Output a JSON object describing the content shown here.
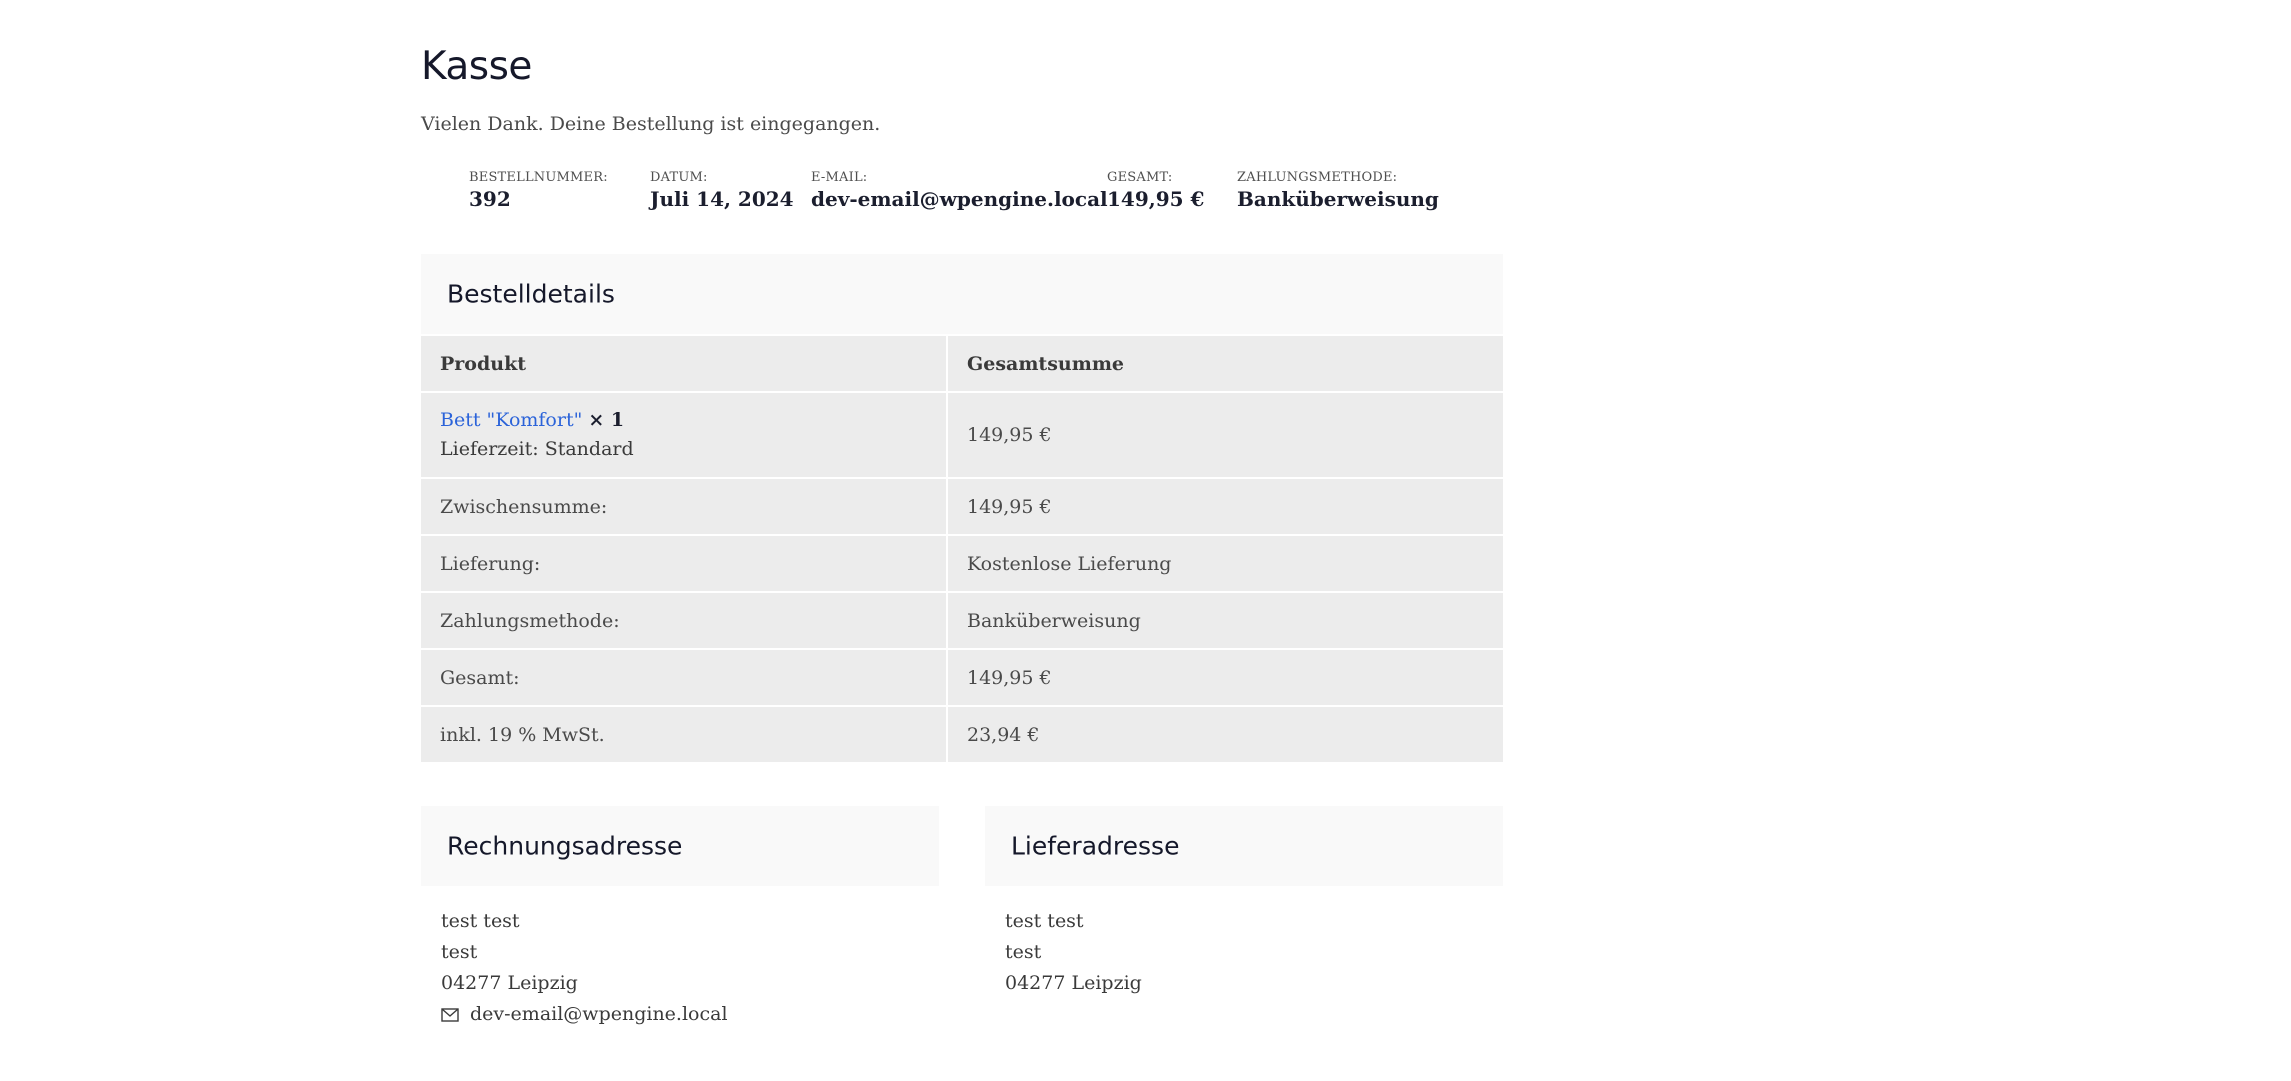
{
  "page": {
    "title": "Kasse",
    "thanks": "Vielen Dank. Deine Bestellung ist eingegangen."
  },
  "overview": {
    "order_number": {
      "label": "BESTELLNUMMER:",
      "value": "392"
    },
    "date": {
      "label": "DATUM:",
      "value": "Juli 14, 2024"
    },
    "email": {
      "label": "E-MAIL:",
      "value": "dev-email@wpengine.local"
    },
    "total": {
      "label": "GESAMT:",
      "value": "149,95 €"
    },
    "payment_method": {
      "label": "ZAHLUNGSMETHODE:",
      "value": "Banküberweisung"
    }
  },
  "order_details": {
    "heading": "Bestelldetails",
    "columns": [
      "Produkt",
      "Gesamtsumme"
    ],
    "product": {
      "name": "Bett \"Komfort\"",
      "quantity": "× 1",
      "meta": "Lieferzeit: Standard",
      "total": "149,95 €"
    },
    "totals": [
      {
        "label": "Zwischensumme:",
        "value": "149,95 €"
      },
      {
        "label": "Lieferung:",
        "value": "Kostenlose Lieferung"
      },
      {
        "label": "Zahlungsmethode:",
        "value": "Banküberweisung"
      },
      {
        "label": "Gesamt:",
        "value": "149,95 €"
      },
      {
        "label": "inkl. 19 % MwSt.",
        "value": "23,94 €"
      }
    ]
  },
  "billing": {
    "heading": "Rechnungsadresse",
    "lines": [
      "test test",
      "test",
      "04277 Leipzig"
    ],
    "email": "dev-email@wpengine.local",
    "email_icon": "envelope-icon"
  },
  "shipping": {
    "heading": "Lieferadresse",
    "lines": [
      "test test",
      "test",
      "04277 Leipzig"
    ]
  },
  "colors": {
    "link": "#2b63d9",
    "table_bg": "#ececec",
    "heading_bg": "#f9f9f9",
    "title": "#15182a"
  }
}
